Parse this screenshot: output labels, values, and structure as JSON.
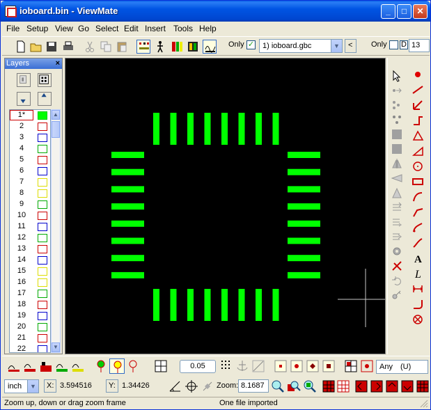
{
  "window": {
    "title": "ioboard.bin - ViewMate",
    "minimize": "_",
    "maximize": "□",
    "close": "✕"
  },
  "menu": [
    "File",
    "Setup",
    "View",
    "Go",
    "Select",
    "Edit",
    "Insert",
    "Tools",
    "Help"
  ],
  "toolbar": {
    "only_label_1": "Only",
    "only_checked_1": "✓",
    "layer_select": "1) ioboard.gbc",
    "only_label_2": "Only",
    "d_label": "D",
    "d_value": "13",
    "back_glyph": "<"
  },
  "layers_panel": {
    "title": "Layers",
    "close": "×",
    "rows": [
      {
        "num": "1*",
        "color": "#00cc00",
        "active": true
      },
      {
        "num": "2",
        "color": "#cc0000"
      },
      {
        "num": "3",
        "color": "#0000cc"
      },
      {
        "num": "4",
        "color": "#00aa00"
      },
      {
        "num": "5",
        "color": "#cc0000"
      },
      {
        "num": "6",
        "color": "#0000cc"
      },
      {
        "num": "7",
        "color": "#dddd00"
      },
      {
        "num": "8",
        "color": "#dddd00"
      },
      {
        "num": "9",
        "color": "#00aa00"
      },
      {
        "num": "10",
        "color": "#cc0000"
      },
      {
        "num": "11",
        "color": "#0000cc"
      },
      {
        "num": "12",
        "color": "#00aa00"
      },
      {
        "num": "13",
        "color": "#cc0000"
      },
      {
        "num": "14",
        "color": "#0000cc"
      },
      {
        "num": "15",
        "color": "#dddd00"
      },
      {
        "num": "16",
        "color": "#dddd00"
      },
      {
        "num": "17",
        "color": "#00aa00"
      },
      {
        "num": "18",
        "color": "#cc0000"
      },
      {
        "num": "19",
        "color": "#0000cc"
      },
      {
        "num": "20",
        "color": "#00aa00"
      },
      {
        "num": "21",
        "color": "#cc0000"
      },
      {
        "num": "22",
        "color": "#0000cc"
      }
    ]
  },
  "canvas": {
    "background": "#000000",
    "pad_color": "#00ff00",
    "cursor_color": "#c8c8c8"
  },
  "bottom": {
    "grid_value": "0.05",
    "any_label": "Any",
    "any_option": "(U)",
    "unit": "inch",
    "x_label": "X:",
    "x_value": "3.594516",
    "y_label": "Y:",
    "y_value": "1.34426",
    "zoom_label": "Zoom:",
    "zoom_value": "8.1687"
  },
  "status": {
    "hint": "Zoom up, down or drag zoom frame",
    "message": "One file imported"
  }
}
